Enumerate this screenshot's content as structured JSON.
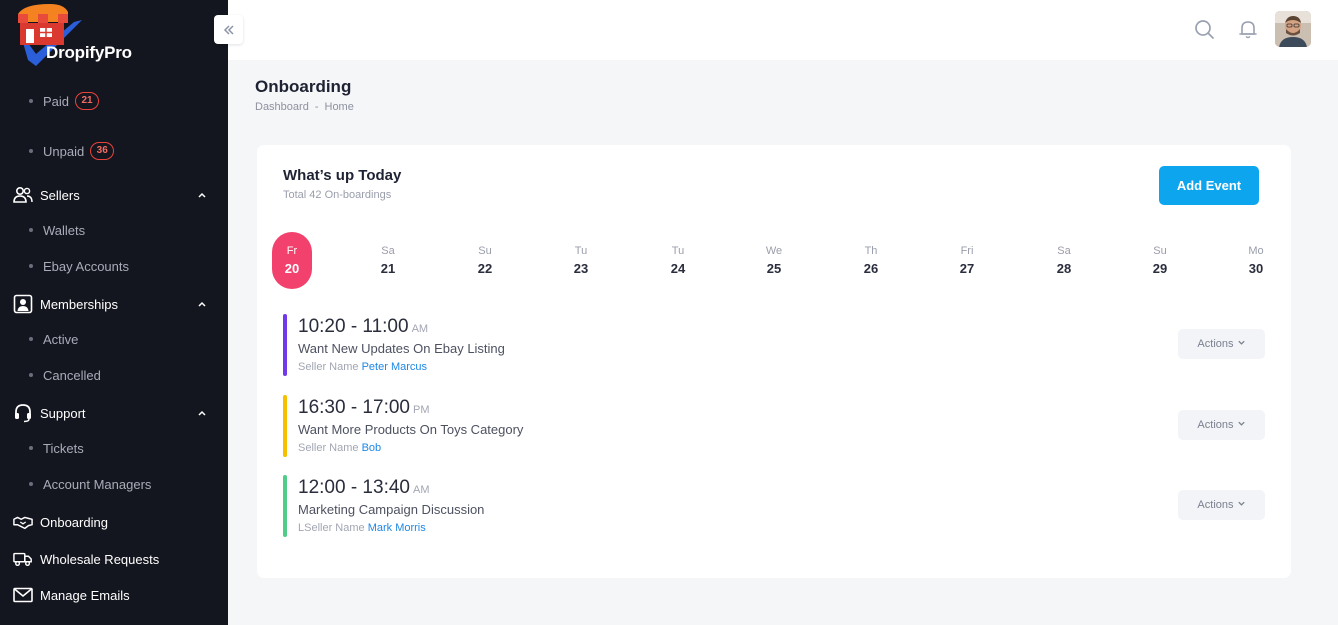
{
  "brand": {
    "name": "DropifyPro"
  },
  "sidebar": {
    "paid": {
      "label": "Paid",
      "count": "21"
    },
    "unpaid": {
      "label": "Unpaid",
      "count": "36"
    },
    "sellers": {
      "label": "Sellers",
      "items": [
        "Wallets",
        "Ebay Accounts"
      ]
    },
    "memberships": {
      "label": "Memberships",
      "items": [
        "Active",
        "Cancelled"
      ]
    },
    "support": {
      "label": "Support",
      "items": [
        "Tickets",
        "Account Managers"
      ]
    },
    "onboarding": {
      "label": "Onboarding"
    },
    "wholesale": {
      "label": "Wholesale Requests"
    },
    "emails": {
      "label": "Manage Emails"
    }
  },
  "page": {
    "title": "Onboarding",
    "breadcrumb": [
      "Dashboard",
      "-",
      "Home"
    ]
  },
  "card": {
    "title": "What’s up Today",
    "subtitle": "Total 42 On-boardings",
    "add_button": "Add Event",
    "days": [
      {
        "name": "Fr",
        "num": "20"
      },
      {
        "name": "Sa",
        "num": "21"
      },
      {
        "name": "Su",
        "num": "22"
      },
      {
        "name": "Tu",
        "num": "23"
      },
      {
        "name": "Tu",
        "num": "24"
      },
      {
        "name": "We",
        "num": "25"
      },
      {
        "name": "Th",
        "num": "26"
      },
      {
        "name": "Fri",
        "num": "27"
      },
      {
        "name": "Sa",
        "num": "28"
      },
      {
        "name": "Su",
        "num": "29"
      },
      {
        "name": "Mo",
        "num": "30"
      }
    ],
    "events": [
      {
        "time": "10:20 - 11:00",
        "ampm": "AM",
        "title": "Want New Updates On Ebay Listing",
        "seller_label": "Seller Name",
        "seller": "Peter Marcus",
        "color": "#7239ea",
        "action": "Actions"
      },
      {
        "time": "16:30 - 17:00",
        "ampm": "PM",
        "title": "Want More Products On Toys Category",
        "seller_label": "Seller Name",
        "seller": "Bob",
        "color": "#f6c000",
        "action": "Actions"
      },
      {
        "time": "12:00 - 13:40",
        "ampm": "AM",
        "title": "Marketing Campaign Discussion",
        "seller_label": "LSeller Name",
        "seller": "Mark Morris",
        "color": "#50cd89",
        "action": "Actions"
      }
    ]
  }
}
